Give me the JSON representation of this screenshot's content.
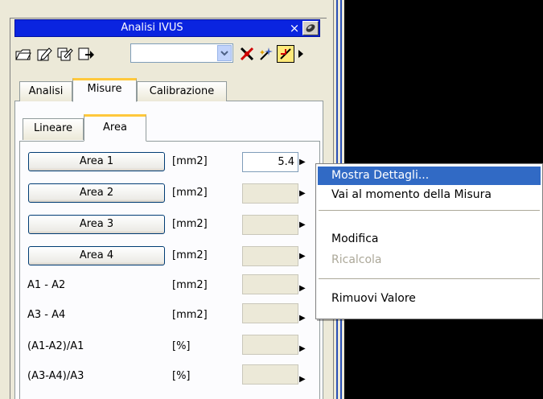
{
  "window": {
    "title": "Analisi IVUS",
    "close_glyph": "×"
  },
  "toolbar": {
    "icons": [
      "open-folder-icon",
      "edit-icon",
      "edit-all-icon",
      "export-icon",
      "measure-icon",
      "wand-icon",
      "diagram-icon",
      "more-arrow-icon"
    ],
    "combo_value": ""
  },
  "tabs": [
    {
      "label": "Analisi",
      "active": false
    },
    {
      "label": "Misure",
      "active": true
    },
    {
      "label": "Calibrazione",
      "active": false
    }
  ],
  "subtabs": [
    {
      "label": "Lineare",
      "active": false
    },
    {
      "label": "Area",
      "active": true
    }
  ],
  "rows": [
    {
      "label": "Area 1",
      "is_button": true,
      "unit": "[mm2]",
      "value": "5.4"
    },
    {
      "label": "Area 2",
      "is_button": true,
      "unit": "[mm2]",
      "value": ""
    },
    {
      "label": "Area 3",
      "is_button": true,
      "unit": "[mm2]",
      "value": ""
    },
    {
      "label": "Area 4",
      "is_button": true,
      "unit": "[mm2]",
      "value": ""
    },
    {
      "label": "A1 - A2",
      "is_button": false,
      "unit": "[mm2]",
      "value": ""
    },
    {
      "label": "A3 - A4",
      "is_button": false,
      "unit": "[mm2]",
      "value": ""
    },
    {
      "label": "(A1-A2)/A1",
      "is_button": false,
      "unit": "[%]",
      "value": ""
    },
    {
      "label": "(A3-A4)/A3",
      "is_button": false,
      "unit": "[%]",
      "value": ""
    }
  ],
  "context_menu": {
    "items": [
      {
        "label": "Mostra Dettagli...",
        "highlighted": true,
        "disabled": false
      },
      {
        "label": "Vai al momento della Misura",
        "highlighted": false,
        "disabled": false
      },
      {
        "label": "Modifica",
        "highlighted": false,
        "disabled": false
      },
      {
        "label": "Ricalcola",
        "highlighted": false,
        "disabled": true
      },
      {
        "label": "Rimuovi Valore",
        "highlighted": false,
        "disabled": false
      }
    ]
  },
  "colors": {
    "titlebar": "#0a24e0",
    "highlight": "#316ac5",
    "tab_accent": "#ffc83c",
    "viewer": "#000000"
  }
}
